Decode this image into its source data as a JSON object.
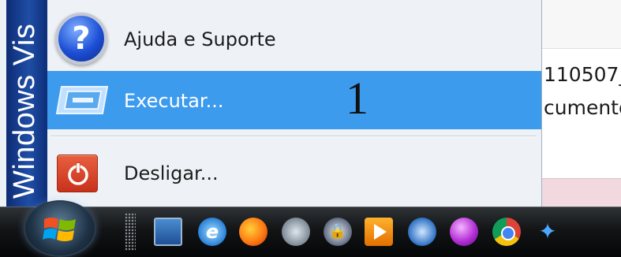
{
  "background_window": {
    "line1": "110507_",
    "line2": "cumento"
  },
  "start_menu": {
    "side_banner": "Windows Vis",
    "items": [
      {
        "label": "Ajuda e Suporte",
        "icon": "help-icon"
      },
      {
        "label": "Executar...",
        "icon": "run-icon",
        "selected": true
      },
      {
        "label": "Desligar...",
        "icon": "power-icon"
      }
    ],
    "annotation": "1",
    "selected_color": "#3d9bee"
  },
  "taskbar": {
    "start_button_icon": "windows-logo-icon",
    "quick_launch": [
      "show-desktop-icon",
      "internet-explorer-icon",
      "firefox-icon",
      "network-icon",
      "security-lock-icon",
      "media-player-icon",
      "quicktime-icon",
      "purple-orb-icon",
      "chrome-icon",
      "tool-icon"
    ]
  }
}
